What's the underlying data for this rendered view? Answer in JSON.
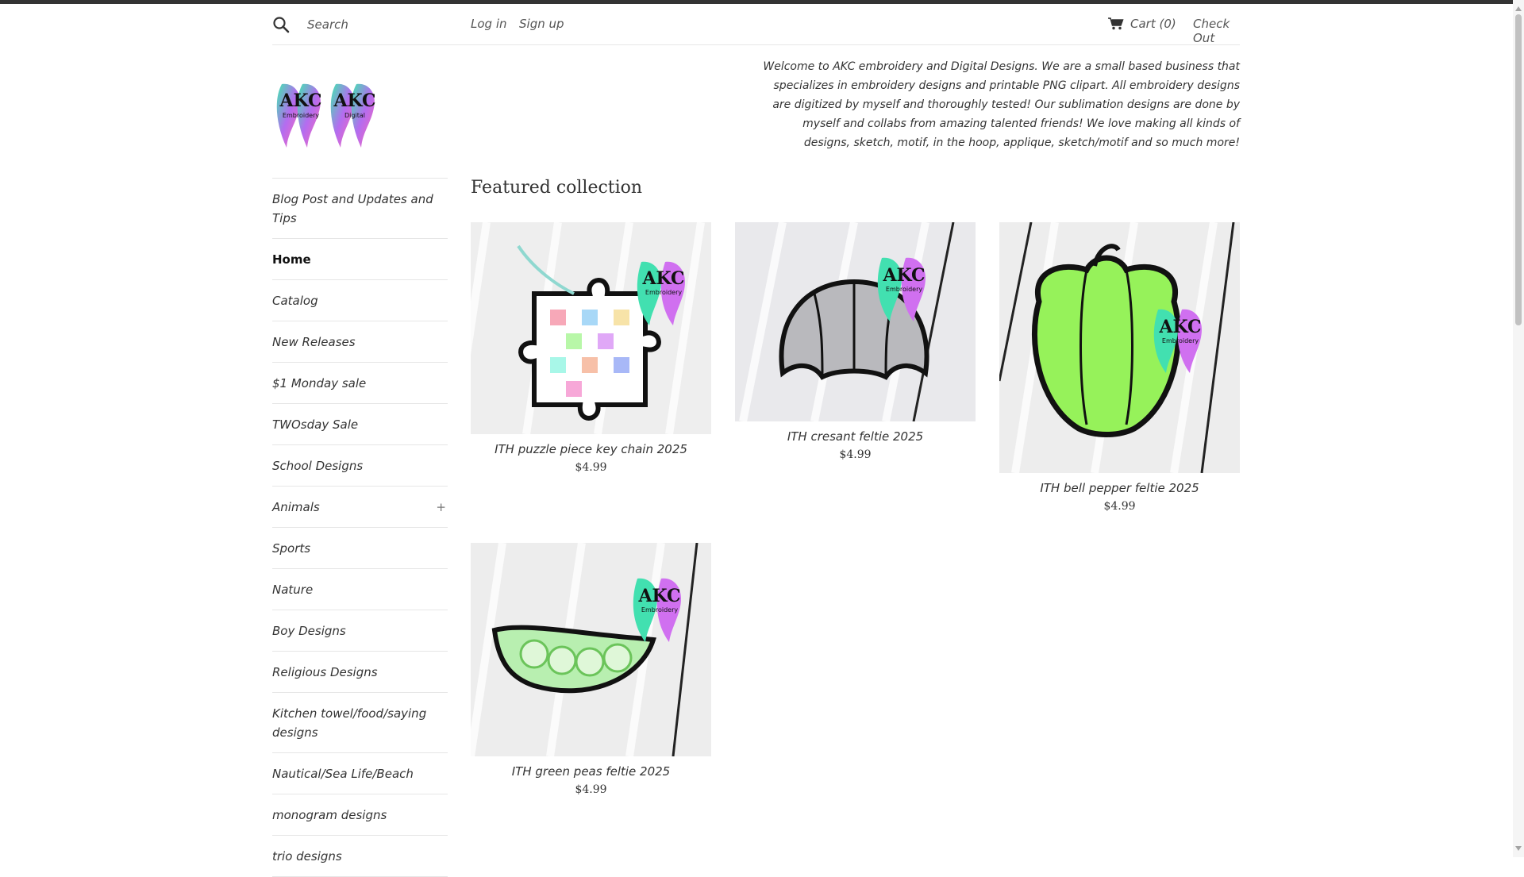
{
  "header": {
    "search_placeholder": "Search",
    "login": "Log in",
    "signup": "Sign up",
    "cart": "Cart (0)",
    "checkout": "Check Out"
  },
  "welcome": "Welcome to AKC embroidery and Digital Designs. We are a small based business that specializes in embroidery designs and printable PNG clipart. All embroidery designs are digitized by myself and thoroughly tested! Our sublimation designs are done by myself and collabs from amazing talented friends! We love making all kinds of designs, sketch, motif, in the hoop, applique, sketch/motif and so much more!",
  "logo": {
    "left_text": "AKC",
    "left_sub": "Embroidery",
    "right_text": "AKC",
    "right_sub": "Digital"
  },
  "sidebar": {
    "items": [
      {
        "label": "Blog Post and Updates and Tips"
      },
      {
        "label": "Home"
      },
      {
        "label": "Catalog"
      },
      {
        "label": "New Releases"
      },
      {
        "label": "$1 Monday sale"
      },
      {
        "label": "TWOsday Sale"
      },
      {
        "label": "School Designs"
      },
      {
        "label": "Animals",
        "expand": "+"
      },
      {
        "label": "Sports"
      },
      {
        "label": "Nature"
      },
      {
        "label": "Boy Designs"
      },
      {
        "label": "Religious Designs"
      },
      {
        "label": "Kitchen towel/food/saying designs"
      },
      {
        "label": "Nautical/Sea Life/Beach"
      },
      {
        "label": "monogram designs"
      },
      {
        "label": "trio designs"
      }
    ]
  },
  "featured": {
    "title": "Featured collection",
    "products": [
      {
        "title": "ITH puzzle piece key chain 2025",
        "price": "$4.99"
      },
      {
        "title": "ITH cresant feltie 2025",
        "price": "$4.99"
      },
      {
        "title": "ITH bell pepper feltie 2025",
        "price": "$4.99"
      },
      {
        "title": "ITH green peas feltie 2025",
        "price": "$4.99"
      }
    ]
  },
  "image_watermark": {
    "text": "AKC",
    "sub": "Embroidery"
  },
  "colors": {
    "accent": "#333333",
    "border": "#e6e6e6"
  }
}
